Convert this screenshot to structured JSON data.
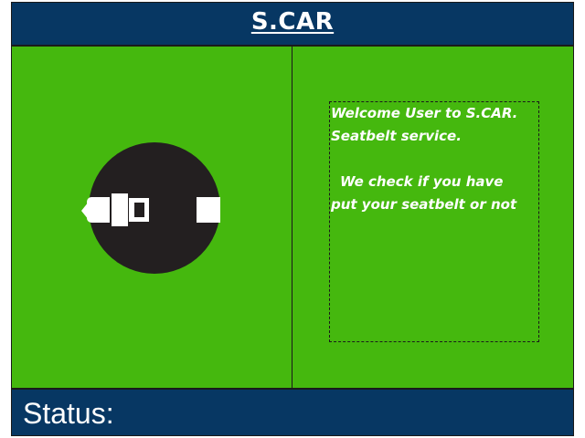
{
  "app": {
    "title": "S.CAR"
  },
  "info": {
    "line1": "Welcome User to S.CAR.",
    "line2": "Seatbelt service.",
    "line3": "We check if you have",
    "line4": "put your seatbelt or not"
  },
  "status": {
    "label": "Status:"
  },
  "icons": {
    "seatbelt": "seatbelt-icon"
  },
  "colors": {
    "header_bg": "#073763",
    "panel_bg": "#45b80e",
    "icon_circle": "#231f20",
    "text": "#ffffff"
  }
}
